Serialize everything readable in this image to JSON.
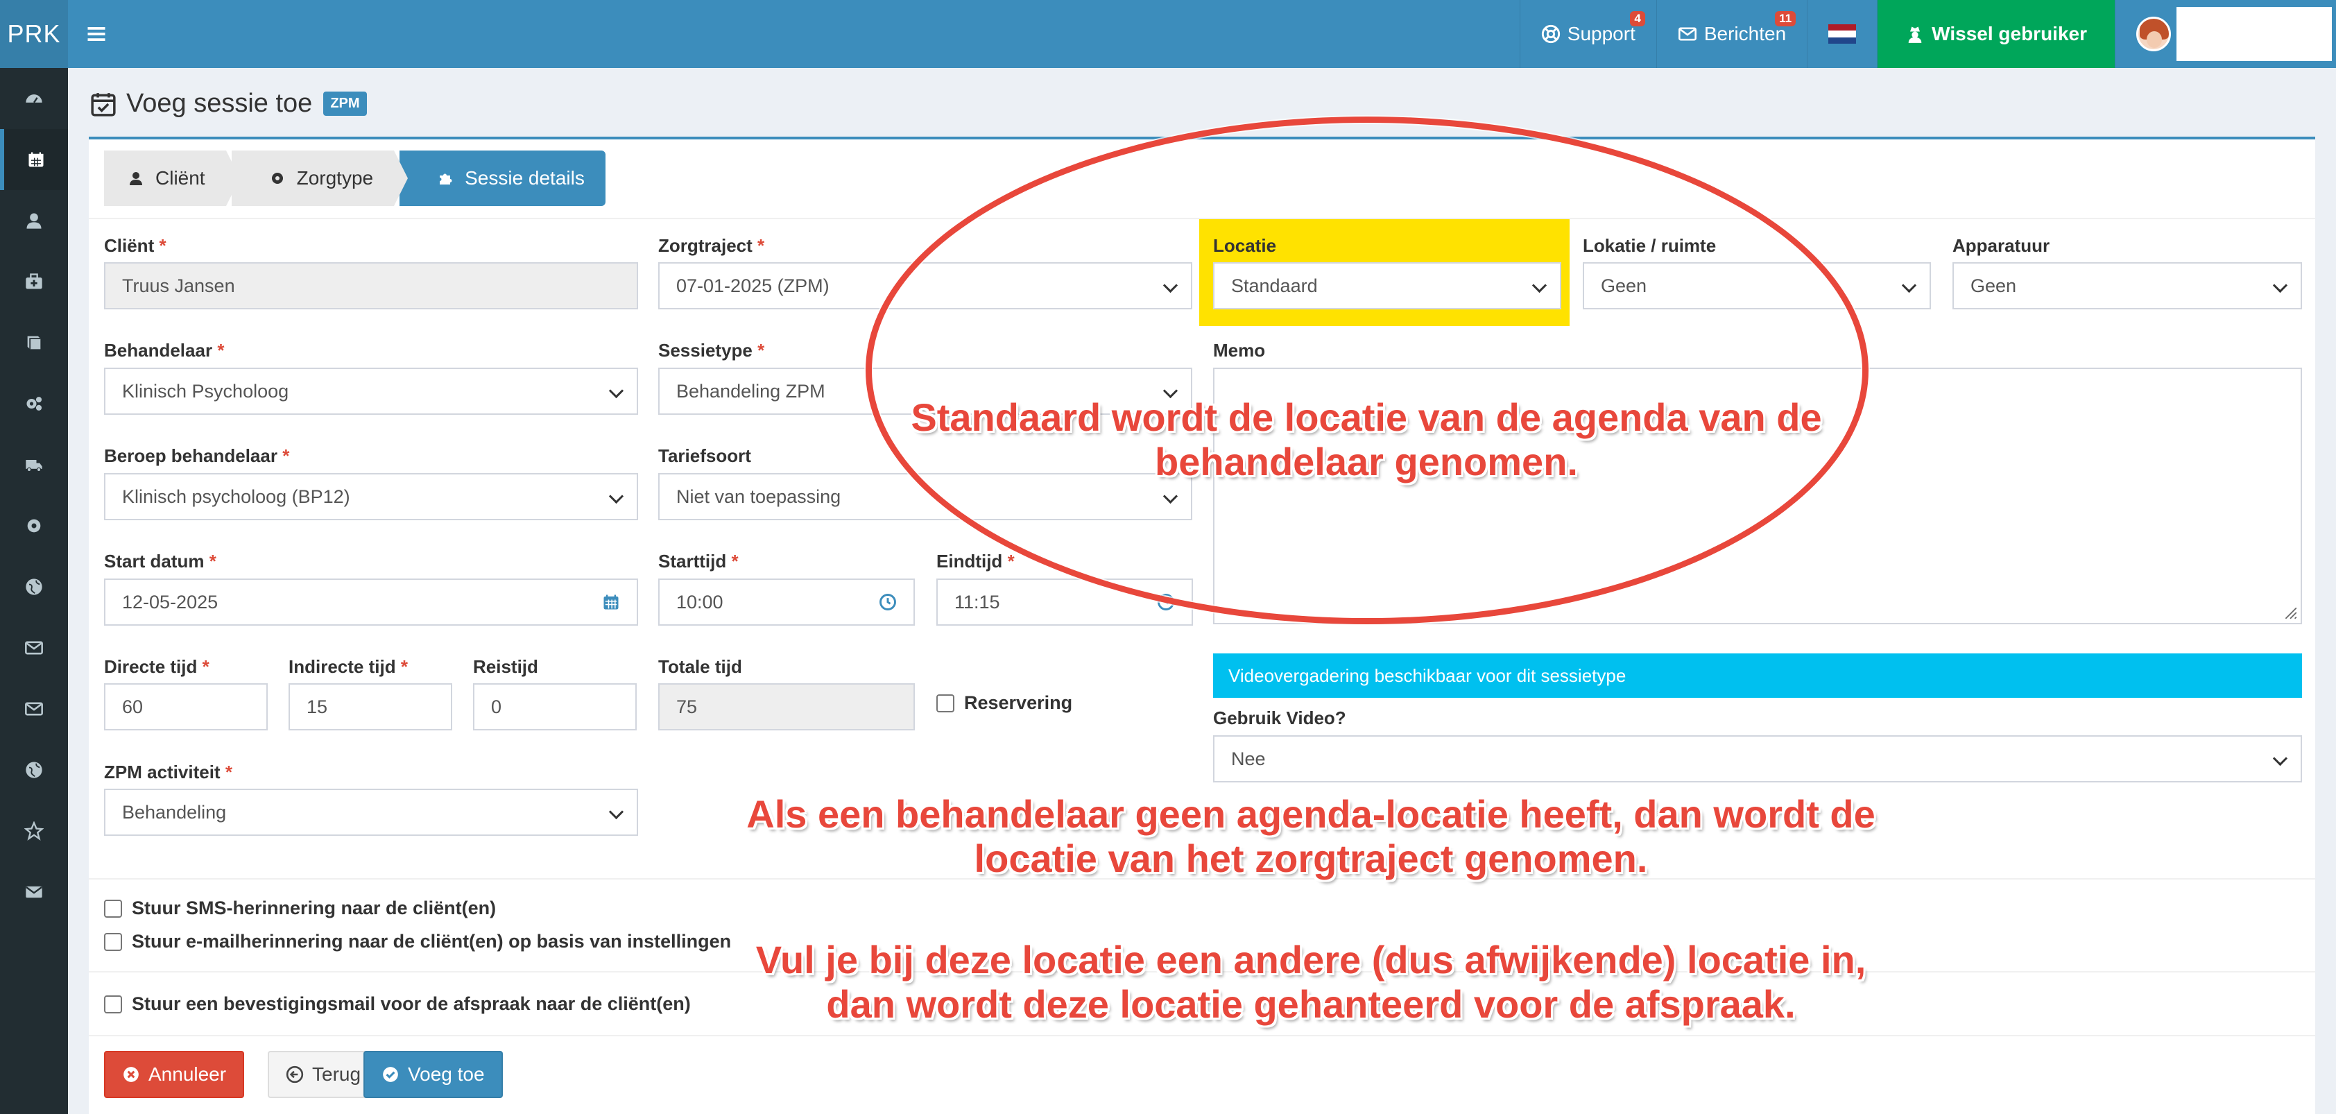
{
  "app": {
    "logo": "PRK"
  },
  "topnav": {
    "support_label": "Support",
    "support_badge": "4",
    "berichten_label": "Berichten",
    "berichten_badge": "11",
    "wissel_label": "Wissel gebruiker"
  },
  "page": {
    "title": "Voeg sessie toe",
    "badge": "ZPM"
  },
  "wizard": {
    "step1": "Cliënt",
    "step2": "Zorgtype",
    "step3": "Sessie details"
  },
  "form": {
    "client": {
      "label": "Cliënt",
      "value": "Truus Jansen"
    },
    "zorgtraject": {
      "label": "Zorgtraject",
      "value": "07-01-2025 (ZPM)"
    },
    "locatie": {
      "label": "Locatie",
      "value": "Standaard"
    },
    "lokatie_ruimte": {
      "label": "Lokatie / ruimte",
      "value": "Geen"
    },
    "apparatuur": {
      "label": "Apparatuur",
      "value": "Geen"
    },
    "behandelaar": {
      "label": "Behandelaar",
      "value": "Klinisch Psycholoog"
    },
    "sessietype": {
      "label": "Sessietype",
      "value": "Behandeling ZPM"
    },
    "memo": {
      "label": "Memo"
    },
    "beroep": {
      "label": "Beroep behandelaar",
      "value": "Klinisch psycholoog (BP12)"
    },
    "tariefsoort": {
      "label": "Tariefsoort",
      "value": "Niet van toepassing"
    },
    "start_datum": {
      "label": "Start datum",
      "value": "12-05-2025"
    },
    "starttijd": {
      "label": "Starttijd",
      "value": "10:00"
    },
    "eindtijd": {
      "label": "Eindtijd",
      "value": "11:15"
    },
    "directe_tijd": {
      "label": "Directe tijd",
      "value": "60"
    },
    "indirecte_tijd": {
      "label": "Indirecte tijd",
      "value": "15"
    },
    "reistijd": {
      "label": "Reistijd",
      "value": "0"
    },
    "totale_tijd": {
      "label": "Totale tijd",
      "value": "75"
    },
    "reservering": {
      "label": "Reservering"
    },
    "video_banner": "Videovergadering beschikbaar voor dit sessietype",
    "gebruik_video": {
      "label": "Gebruik Video?",
      "value": "Nee"
    },
    "zpm_activiteit": {
      "label": "ZPM activiteit",
      "value": "Behandeling"
    },
    "required_mark": "*"
  },
  "checkboxes": {
    "sms": "Stuur SMS-herinnering naar de cliënt(en)",
    "email": "Stuur e-mailherinnering naar de cliënt(en) op basis van instellingen",
    "bevestiging": "Stuur een bevestigingsmail voor de afspraak naar de cliënt(en)"
  },
  "buttons": {
    "annuleer": "Annuleer",
    "terug": "Terug",
    "voeg_toe": "Voeg toe"
  },
  "annotations": {
    "line1a": "Standaard wordt de locatie van de agenda van de",
    "line1b": "behandelaar genomen.",
    "line2a": "Als een behandelaar geen agenda-locatie heeft, dan wordt de",
    "line2b": "locatie van het zorgtraject genomen.",
    "line3a": "Vul je bij deze locatie een andere (dus afwijkende) locatie in,",
    "line3b": "dan wordt deze locatie gehanteerd voor de afspraak."
  },
  "colors": {
    "primary": "#3c8dbc",
    "success": "#00a65a",
    "danger": "#dd4b39",
    "info": "#00c0ef",
    "highlight": "#ffe200",
    "annotation": "#e8473b"
  }
}
